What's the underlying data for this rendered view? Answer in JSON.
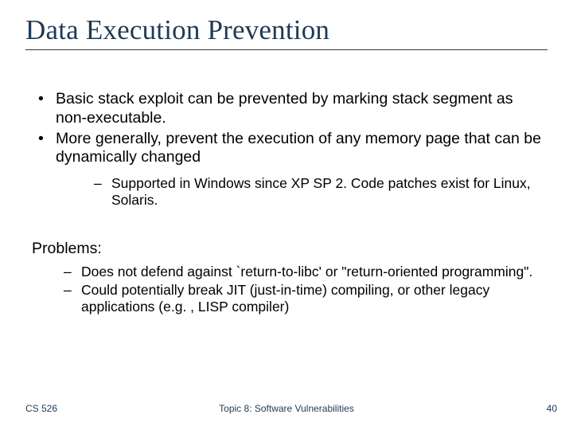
{
  "slide": {
    "title": "Data Execution Prevention",
    "bullets": [
      "Basic stack exploit can be prevented by marking stack segment as non-executable.",
      "More generally, prevent the execution of any memory page that can be dynamically changed"
    ],
    "sub_bullets_after_bullet2": [
      "Supported in Windows since XP SP 2.  Code patches exist for Linux, Solaris."
    ],
    "problems_label": "Problems:",
    "problems": [
      "Does not defend against `return-to-libc' or \"return-oriented programming\".",
      "Could potentially break JIT (just-in-time) compiling, or other legacy applications (e.g. , LISP compiler)"
    ],
    "footer": {
      "left": "CS 526",
      "center": "Topic 8: Software Vulnerabilities",
      "page": "40"
    }
  }
}
